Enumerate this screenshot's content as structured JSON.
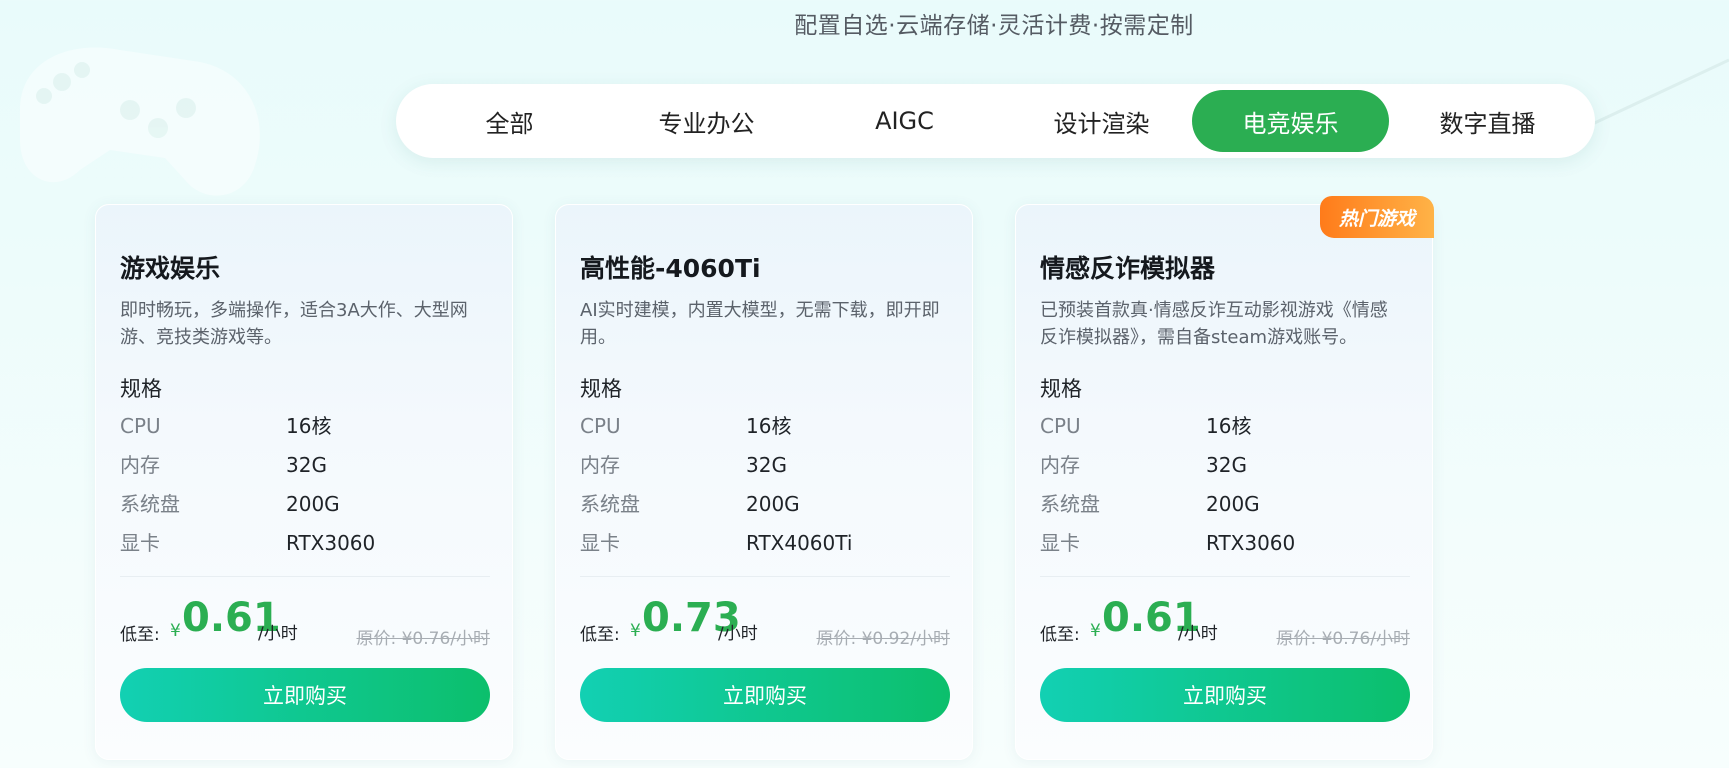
{
  "header": {
    "subtitle": "配置自选·云端存储·灵活计费·按需定制"
  },
  "tabs": [
    {
      "label": "全部",
      "active": false
    },
    {
      "label": "专业办公",
      "active": false
    },
    {
      "label": "AIGC",
      "active": false
    },
    {
      "label": "设计渲染",
      "active": false
    },
    {
      "label": "电竞娱乐",
      "active": true
    },
    {
      "label": "数字直播",
      "active": false
    }
  ],
  "colors": {
    "accent": "#2bae52",
    "button_gradient_start": "#12d0b3",
    "button_gradient_end": "#0cbf6c",
    "badge_start": "#ff7b1a",
    "badge_end": "#ffb347"
  },
  "cards": [
    {
      "title": "游戏娱乐",
      "desc": "即时畅玩，多端操作，适合3A大作、大型网游、竞技类游戏等。",
      "spec_heading": "规格",
      "specs": [
        {
          "key": "CPU",
          "value": "16核"
        },
        {
          "key": "内存",
          "value": "32G"
        },
        {
          "key": "系统盘",
          "value": "200G"
        },
        {
          "key": "显卡",
          "value": "RTX3060"
        }
      ],
      "price_label": "低至:",
      "currency": "¥",
      "price": "0.61",
      "unit": "/小时",
      "original_price": "原价: ¥0.76/小时",
      "buy_label": "立即购买",
      "badge": ""
    },
    {
      "title": "高性能-4060Ti",
      "desc": "AI实时建模，内置大模型，无需下载，即开即用。",
      "spec_heading": "规格",
      "specs": [
        {
          "key": "CPU",
          "value": "16核"
        },
        {
          "key": "内存",
          "value": "32G"
        },
        {
          "key": "系统盘",
          "value": "200G"
        },
        {
          "key": "显卡",
          "value": "RTX4060Ti"
        }
      ],
      "price_label": "低至:",
      "currency": "¥",
      "price": "0.73",
      "unit": "/小时",
      "original_price": "原价: ¥0.92/小时",
      "buy_label": "立即购买",
      "badge": ""
    },
    {
      "title": "情感反诈模拟器",
      "desc": "已预装首款真·情感反诈互动影视游戏《情感反诈模拟器》，需自备steam游戏账号。",
      "spec_heading": "规格",
      "specs": [
        {
          "key": "CPU",
          "value": "16核"
        },
        {
          "key": "内存",
          "value": "32G"
        },
        {
          "key": "系统盘",
          "value": "200G"
        },
        {
          "key": "显卡",
          "value": "RTX3060"
        }
      ],
      "price_label": "低至:",
      "currency": "¥",
      "price": "0.61",
      "unit": "/小时",
      "original_price": "原价: ¥0.76/小时",
      "buy_label": "立即购买",
      "badge": "热门游戏"
    }
  ]
}
